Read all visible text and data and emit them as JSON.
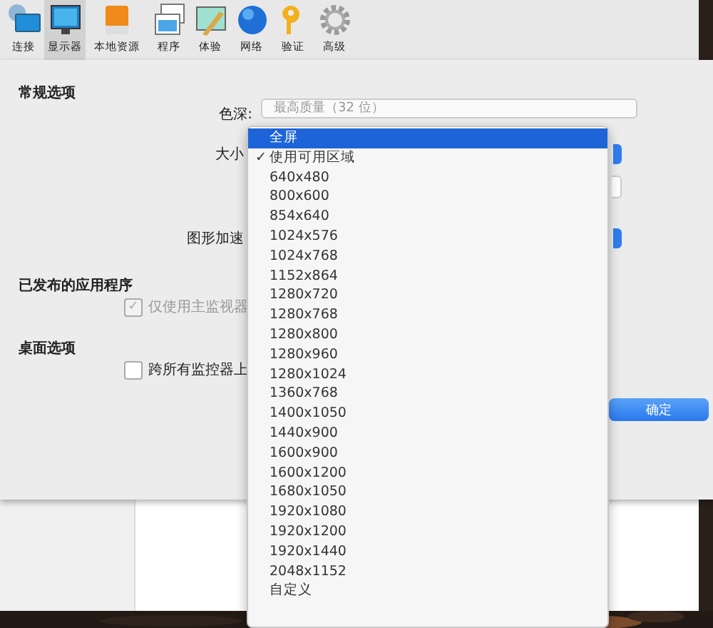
{
  "toolbar": [
    {
      "label": "连接",
      "selected": false
    },
    {
      "label": "显示器",
      "selected": true
    },
    {
      "label": "本地资源",
      "selected": false
    },
    {
      "label": "程序",
      "selected": false
    },
    {
      "label": "体验",
      "selected": false
    },
    {
      "label": "网络",
      "selected": false
    },
    {
      "label": "验证",
      "selected": false
    },
    {
      "label": "高级",
      "selected": false
    }
  ],
  "general": {
    "heading": "常规选项",
    "color_depth_label": "色深:",
    "color_depth_value": "最高质量（32 位）",
    "size_label": "大小",
    "graphics_label": "图形加速"
  },
  "published_apps": {
    "heading": "已发布的应用程序",
    "checkbox": {
      "label": "仅使用主监视器",
      "checked": true,
      "disabled": true
    }
  },
  "desktop": {
    "heading": "桌面选项",
    "checkbox": {
      "label": "跨所有监控器上",
      "checked": false,
      "disabled": false
    }
  },
  "ok_button": "确定",
  "size_menu": [
    {
      "label": "全屏",
      "highlighted": true,
      "checked": false
    },
    {
      "label": "使用可用区域",
      "highlighted": false,
      "checked": true
    },
    {
      "label": "640x480",
      "highlighted": false,
      "checked": false
    },
    {
      "label": "800x600",
      "highlighted": false,
      "checked": false
    },
    {
      "label": "854x640",
      "highlighted": false,
      "checked": false
    },
    {
      "label": "1024x576",
      "highlighted": false,
      "checked": false
    },
    {
      "label": "1024x768",
      "highlighted": false,
      "checked": false
    },
    {
      "label": "1152x864",
      "highlighted": false,
      "checked": false
    },
    {
      "label": "1280x720",
      "highlighted": false,
      "checked": false
    },
    {
      "label": "1280x768",
      "highlighted": false,
      "checked": false
    },
    {
      "label": "1280x800",
      "highlighted": false,
      "checked": false
    },
    {
      "label": "1280x960",
      "highlighted": false,
      "checked": false
    },
    {
      "label": "1280x1024",
      "highlighted": false,
      "checked": false
    },
    {
      "label": "1360x768",
      "highlighted": false,
      "checked": false
    },
    {
      "label": "1400x1050",
      "highlighted": false,
      "checked": false
    },
    {
      "label": "1440x900",
      "highlighted": false,
      "checked": false
    },
    {
      "label": "1600x900",
      "highlighted": false,
      "checked": false
    },
    {
      "label": "1600x1200",
      "highlighted": false,
      "checked": false
    },
    {
      "label": "1680x1050",
      "highlighted": false,
      "checked": false
    },
    {
      "label": "1920x1080",
      "highlighted": false,
      "checked": false
    },
    {
      "label": "1920x1200",
      "highlighted": false,
      "checked": false
    },
    {
      "label": "1920x1440",
      "highlighted": false,
      "checked": false
    },
    {
      "label": "2048x1152",
      "highlighted": false,
      "checked": false
    },
    {
      "label": "自定义",
      "highlighted": false,
      "checked": false
    }
  ],
  "check_glyph": "✓"
}
